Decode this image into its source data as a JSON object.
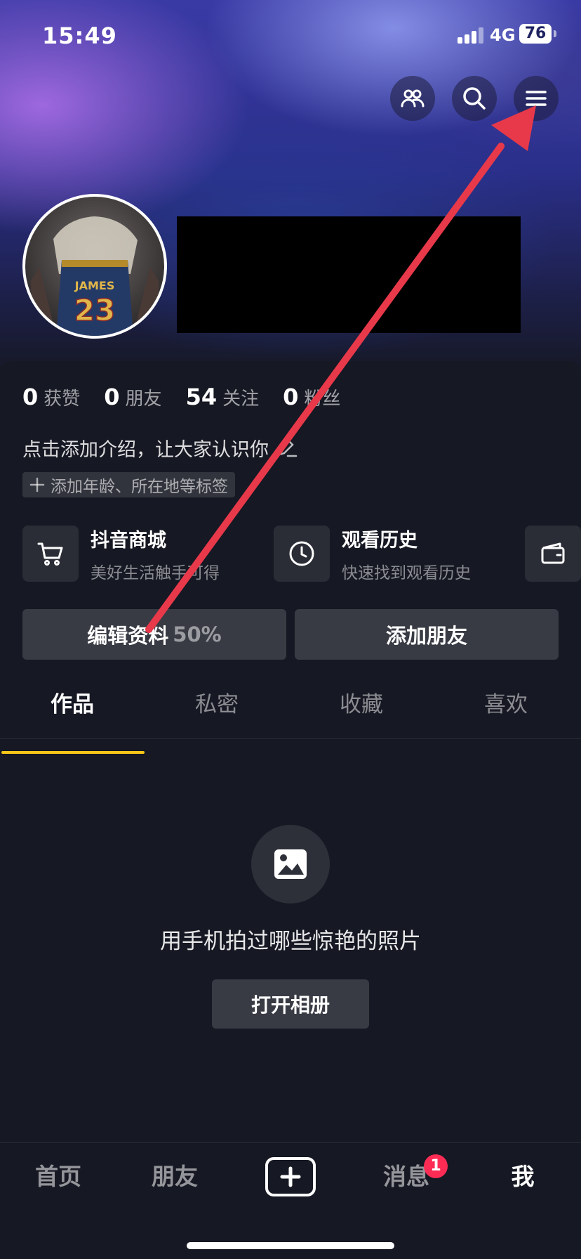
{
  "status_bar": {
    "time": "15:49",
    "network": "4G",
    "battery": "76"
  },
  "header": {
    "friends_icon": "people-icon",
    "search_icon": "search-icon",
    "menu_icon": "hamburger-menu-icon"
  },
  "profile": {
    "stats": [
      {
        "num": "0",
        "label": "获赞"
      },
      {
        "num": "0",
        "label": "朋友"
      },
      {
        "num": "54",
        "label": "关注"
      },
      {
        "num": "0",
        "label": "粉丝"
      }
    ],
    "bio": "点击添加介绍，让大家认识你",
    "tag_chip": "添加年龄、所在地等标签",
    "avatar_text_1": "JAMES",
    "avatar_text_2": "23"
  },
  "shortcuts": [
    {
      "title": "抖音商城",
      "sub": "美好生活触手可得",
      "icon": "cart-icon"
    },
    {
      "title": "观看历史",
      "sub": "快速找到观看历史",
      "icon": "clock-icon"
    },
    {
      "icon": "wallet-icon"
    }
  ],
  "actions": {
    "edit_profile": "编辑资料",
    "edit_progress": "50%",
    "add_friend": "添加朋友"
  },
  "tabs": [
    "作品",
    "私密",
    "收藏",
    "喜欢"
  ],
  "active_tab": "作品",
  "empty_state": {
    "icon": "image-icon",
    "text": "用手机拍过哪些惊艳的照片",
    "button": "打开相册"
  },
  "bottom_nav": {
    "items": [
      "首页",
      "朋友",
      "消息",
      "我"
    ],
    "messages_badge": "1",
    "active": "我"
  },
  "colors": {
    "background": "#161823",
    "tab_underline": "#f5c518",
    "badge": "#fe2c55",
    "arrow": "#e8394a"
  }
}
